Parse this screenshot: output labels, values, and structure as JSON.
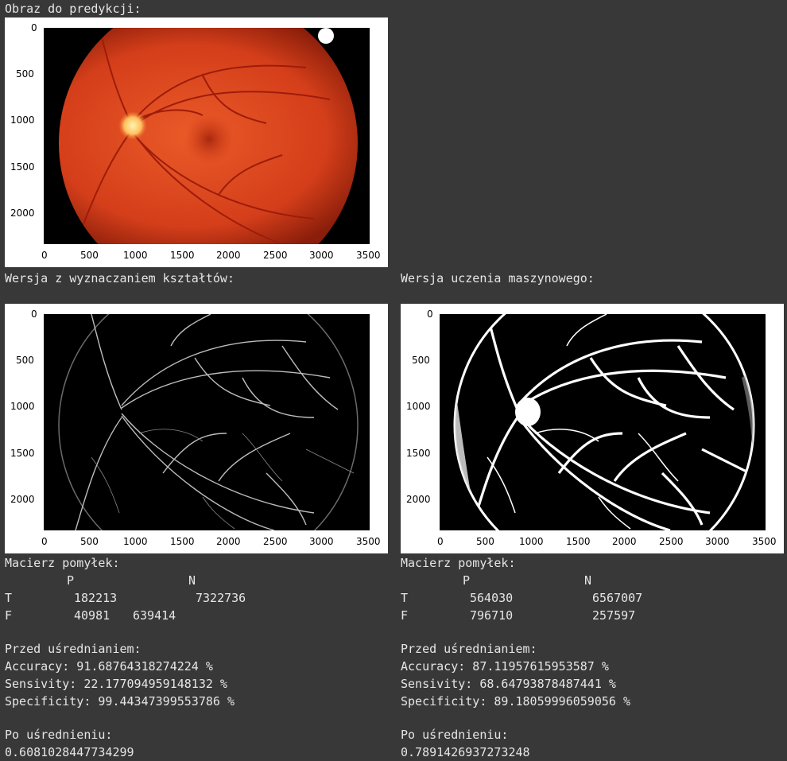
{
  "header": {
    "prediction_title": "Obraz do predykcji:"
  },
  "sections": {
    "shape_title": "Wersja z wyznaczaniem kształtów:",
    "ml_title": "Wersja uczenia maszynowego:"
  },
  "axes": {
    "x_ticks": [
      "0",
      "500",
      "1000",
      "1500",
      "2000",
      "2500",
      "3000",
      "3500"
    ],
    "y_ticks": [
      "0",
      "500",
      "1000",
      "1500",
      "2000"
    ]
  },
  "colors": {
    "background": "#383838",
    "text": "#e6e6e6",
    "fundus": "#d8401c"
  },
  "shape_results": {
    "matrix_title": "Macierz pomyłek:",
    "col_p": "P",
    "col_n": "N",
    "row_t": "T",
    "row_f": "F",
    "tp": "182213",
    "tn": "7322736",
    "fp": "40981",
    "fn": "639414",
    "before_title": "Przed uśrednianiem:",
    "accuracy": "Accuracy: 91.68764318274224 %",
    "sensivity": "Sensivity: 22.177094959148132 %",
    "specificity": "Specificity: 99.44347399553786 %",
    "after_title": "Po uśrednieniu:",
    "after_value": "0.6081028447734299"
  },
  "ml_results": {
    "matrix_title": "Macierz pomyłek:",
    "col_p": "P",
    "col_n": "N",
    "row_t": "T",
    "row_f": "F",
    "tp": "564030",
    "tn": "6567007",
    "fp": "796710",
    "fn": "257597",
    "before_title": "Przed uśrednianiem:",
    "accuracy": "Accuracy: 87.11957615953587 %",
    "sensivity": "Sensivity: 68.64793878487441 %",
    "specificity": "Specificity: 89.18059996059056 %",
    "after_title": "Po uśrednieniu:",
    "after_value": "0.7891426937273248"
  }
}
